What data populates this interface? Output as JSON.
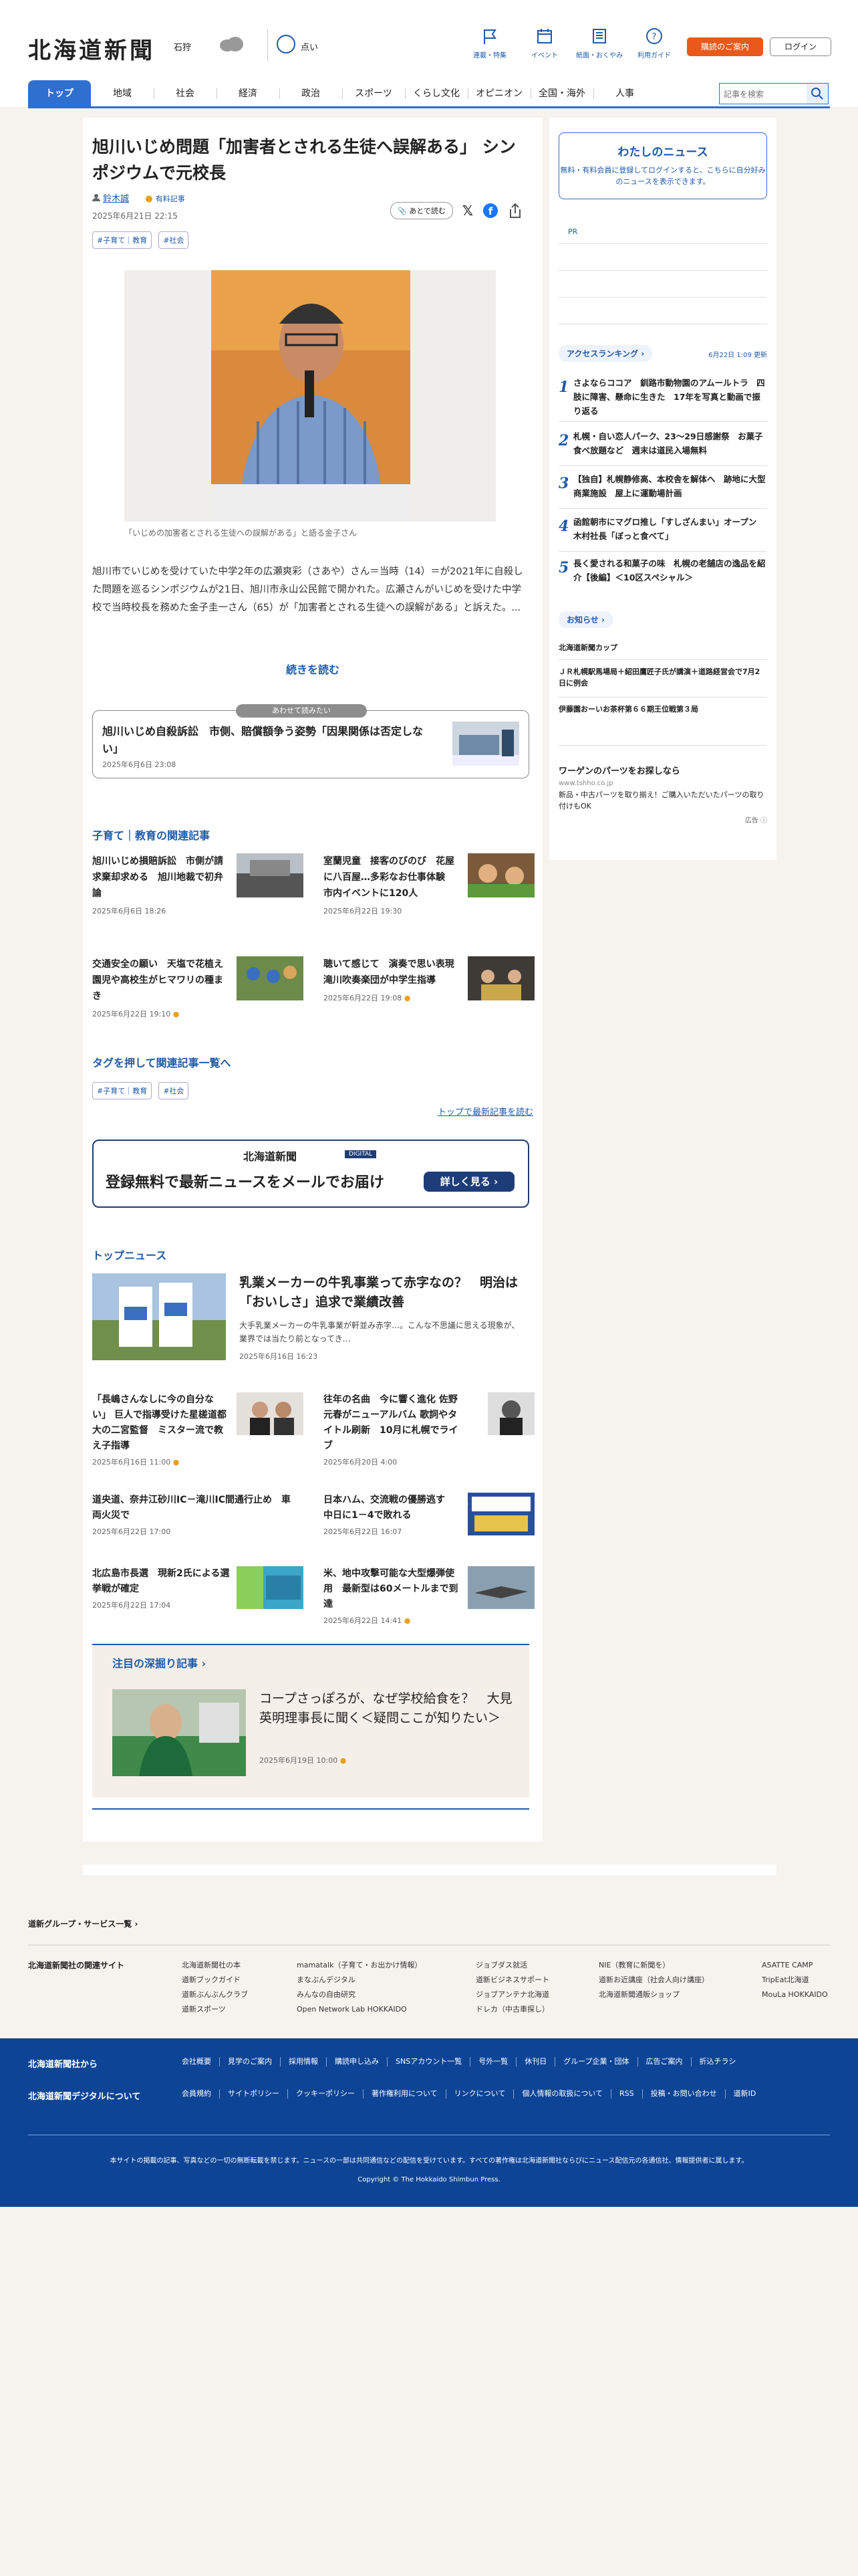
{
  "header": {
    "logo": "北海道新聞",
    "region": "石狩",
    "weather": "曇り",
    "temp": "点い",
    "nav": [
      "連載・特集",
      "イベント",
      "紙面・おくやみ",
      "利用ガイド"
    ],
    "subscribe": "購読のご案内",
    "login": "ログイン",
    "categories": [
      "トップ",
      "地域",
      "社会",
      "経済",
      "政治",
      "スポーツ",
      "くらし文化",
      "オピニオン",
      "全国・海外",
      "人事"
    ],
    "search_placeholder": "記事を検索"
  },
  "article": {
    "title": "旭川いじめ問題「加害者とされる生徒へ誤解ある」 シンポジウムで元校長",
    "author": "鈴木誠",
    "badge": "有料記事",
    "date": "2025年6月21日 22:15",
    "tags": [
      "#子育て｜教育",
      "#社会"
    ],
    "read_later": "あとで読む",
    "caption": "「いじめの加害者とされる生徒への誤解がある」と語る金子さん",
    "lead": "旭川市でいじめを受けていた中学2年の広瀬爽彩（さあや）さん＝当時（14）＝が2021年に自殺した問題を巡るシンポジウムが21日、旭川市永山公民館で開かれた。広瀬さんがいじめを受けた中学校で当時校長を務めた金子圭一さん（65）が「加害者とされる生徒への誤解がある」と訴えた。...",
    "continue": "続きを読む"
  },
  "recommend": {
    "label": "あわせて読みたい",
    "title": "旭川いじめ自殺訴訟　市側、賠償額争う姿勢「因果関係は否定しない」",
    "date": "2025年6月6日 23:08"
  },
  "related": {
    "title": "子育て｜教育の関連記事",
    "items": [
      {
        "title": "旭川いじめ損賠訴訟　市側が請求棄却求める　旭川地裁で初弁論",
        "date": "2025年6月6日 18:26"
      },
      {
        "title": "室蘭児童　接客のびのび　花屋に八百屋…多彩なお仕事体験　市内イベントに120人",
        "date": "2025年6月22日 19:30"
      },
      {
        "title": "交通安全の願い　天塩で花植え　園児や高校生がヒマワリの種まき",
        "date": "2025年6月22日 19:10"
      },
      {
        "title": "聴いて感じて　演奏で思い表現　滝川吹奏楽団が中学生指導",
        "date": "2025年6月22日 19:08"
      }
    ]
  },
  "tags_section": {
    "title": "タグを押して関連記事一覧へ",
    "tags": [
      "#子育て｜教育",
      "#社会"
    ],
    "latest_link": "トップで最新記事を読む"
  },
  "cta": {
    "logo": "北海道新聞",
    "digital": "DIGITAL",
    "text": "登録無料で最新ニュースをメールでお届け",
    "button": "詳しく見る"
  },
  "top_news": {
    "title": "トップニュース",
    "main": {
      "title": "乳業メーカーの牛乳事業って赤字なの？　明治は「おいしさ」追求で業績改善",
      "summary": "大手乳業メーカーの牛乳事業が軒並み赤字…。こんな不思議に思える現象が、業界では当たり前となってき…",
      "date": "2025年6月16日 16:23"
    },
    "items": [
      {
        "title": "「長嶋さんなしに今の自分ない」 巨人で指導受けた星槎道都大の二宮監督　ミスター流で教え子指導",
        "date": "2025年6月16日 11:00"
      },
      {
        "title": "往年の名曲　今に響く進化 佐野元春がニューアルバム 歌詞やタイトル刷新　10月に札幌でライブ",
        "date": "2025年6月20日 4:00"
      },
      {
        "title": "道央道、奈井江砂川IC－滝川IC間通行止め　車両火災で",
        "date": "2025年6月22日 17:00"
      },
      {
        "title": "日本ハム、交流戦の優勝逃す　中日に1－4で敗れる",
        "date": "2025年6月22日 16:07"
      },
      {
        "title": "北広島市長選　現新2氏による選挙戦が確定",
        "date": "2025年6月22日 17:04"
      },
      {
        "title": "米、地中攻撃可能な大型爆弾使用　最新型は60メートルまで到達",
        "date": "2025年6月22日 14:41"
      }
    ]
  },
  "deep": {
    "title": "注目の深掘り記事",
    "headline": "コープさっぽろが、なぜ学校給食を？　大見英明理事長に聞く＜疑問ここが知りたい＞",
    "date": "2025年6月19日 10:00"
  },
  "sidebar": {
    "mynews_title": "わたしのニュース",
    "mynews_text": "無料・有料会員に登録してログインすると、こちらに自分好みのニュースを表示できます。",
    "pr": "PR",
    "ranking_title": "アクセスランキング",
    "ranking_time": "6月22日 1:09 更新",
    "ranking": [
      "さよならココア　釧路市動物園のアムールトラ　四肢に障害、懸命に生きた　17年を写真と動画で振り返る",
      "札幌・自い恋人パーク、23～29日感謝祭　お菓子食べ放題など　週末は道民入場無料",
      "【独自】札幌静修高、本校舎を解体へ　跡地に大型商業施設　屋上に運動場計画",
      "函館朝市にマグロ推し「すしざんまい」オープン　木村社長「ぼっと食べて」",
      "長く愛される和菓子の味　札幌の老舗店の逸品を紹介【後編】＜10区スペシャル＞"
    ],
    "notice_title": "お知らせ",
    "notices": [
      "北海道新聞カップ",
      "ＪＲ札幌駅馬場局＋紹田鷹匠子氏が講演＋道路経営会で7月2日に例会",
      "伊藤園おーいお茶杯第６６期王位戦第３局"
    ],
    "ad_title": "ワーゲンのパーツをお探しなら",
    "ad_url": "www.tshho.co.jp",
    "ad_text": "新品・中古パーツを取り揃え！ご購入いただいたパーツの取り付けもOK",
    "ad_mark": "広告"
  },
  "footer": {
    "group_link": "道新グループ・サービス一覧",
    "related_sites_title": "北海道新聞社の関連サイト",
    "sites": [
      [
        "北海道新聞社の本",
        "道新ブックガイド",
        "道新ぶんぶんクラブ",
        "道新スポーツ"
      ],
      [
        "mamatalk（子育て・お出かけ情報）",
        "まなぶんデジタル",
        "みんなの自由研究",
        "Open Network Lab HOKKAIDO"
      ],
      [
        "ジョブダス就活",
        "道新ビジネスサポート",
        "ジョブアンテナ北海道",
        "ドレカ（中古車探し）"
      ],
      [
        "NIE（教育に新聞を）",
        "道新お近講座（社会人向け講座）",
        "北海道新聞通販ショップ"
      ],
      [
        "ASATTE CAMP",
        "TripEat北海道",
        "MouLa HOKKAIDO"
      ]
    ],
    "company": "北海道新聞社から",
    "digital": "北海道新聞デジタルについて",
    "links1": [
      "会社概要",
      "見学のご案内",
      "採用情報",
      "購読申し込み",
      "SNSアカウント一覧",
      "号外一覧",
      "休刊日",
      "グループ企業・団体",
      "広告ご案内",
      "折込チラシ"
    ],
    "links2": [
      "会員規約",
      "サイトポリシー",
      "クッキーポリシー",
      "著作権利用について",
      "リンクについて",
      "個人情報の取扱について",
      "RSS",
      "投稿・お問い合わせ",
      "道新ID"
    ],
    "note": "本サイトの掲載の記事、写真などの一切の無断転載を禁じます。ニュースの一部は共同通信などの配信を受けています。すべての著作権は北海道新聞社ならびにニュース配信元の各通信社、情報提供者に属します。",
    "copyright": "Copyright © The Hokkaido Shimbun Press."
  }
}
